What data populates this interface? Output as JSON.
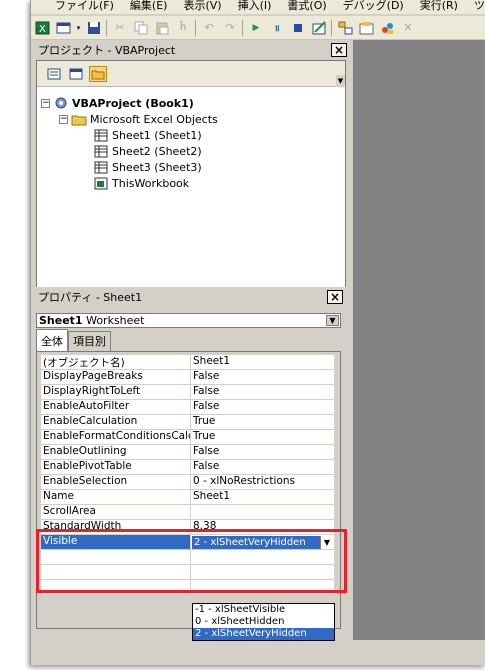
{
  "menubar": {
    "items": [
      "ファイル(F)",
      "編集(E)",
      "表示(V)",
      "挿入(I)",
      "書式(O)",
      "デバッグ(D)",
      "実行(R)",
      "ツ"
    ]
  },
  "toolbar": {
    "icons": [
      "excel-icon",
      "insert-module-icon",
      "save-icon",
      "cut-icon",
      "copy-icon",
      "paste-icon",
      "find-icon",
      "undo-icon",
      "redo-icon",
      "run-icon",
      "pause-icon",
      "stop-icon",
      "design-mode-icon",
      "project-explorer-icon",
      "properties-icon",
      "object-browser-icon",
      "toolbox-icon"
    ]
  },
  "project_explorer": {
    "title": "プロジェクト - VBAProject",
    "close": "×",
    "tree": {
      "root": "VBAProject (Book1)",
      "folder": "Microsoft Excel Objects",
      "items": [
        "Sheet1 (Sheet1)",
        "Sheet2 (Sheet2)",
        "Sheet3 (Sheet3)",
        "ThisWorkbook"
      ]
    }
  },
  "properties": {
    "title": "プロパティ - Sheet1",
    "close": "×",
    "object_name": "Sheet1",
    "object_type": "Worksheet",
    "tabs": [
      "全体",
      "項目別"
    ],
    "rows": [
      {
        "name": "(オブジェクト名)",
        "value": "Sheet1"
      },
      {
        "name": "DisplayPageBreaks",
        "value": "False"
      },
      {
        "name": "DisplayRightToLeft",
        "value": "False"
      },
      {
        "name": "EnableAutoFilter",
        "value": "False"
      },
      {
        "name": "EnableCalculation",
        "value": "True"
      },
      {
        "name": "EnableFormatConditionsCalculation",
        "value": "True"
      },
      {
        "name": "EnableOutlining",
        "value": "False"
      },
      {
        "name": "EnablePivotTable",
        "value": "False"
      },
      {
        "name": "EnableSelection",
        "value": "0 - xlNoRestrictions"
      },
      {
        "name": "Name",
        "value": "Sheet1"
      },
      {
        "name": "ScrollArea",
        "value": ""
      },
      {
        "name": "StandardWidth",
        "value": "8.38"
      }
    ],
    "visible": {
      "name": "Visible",
      "value": "2 - xlSheetVeryHidden",
      "options": [
        "-1 - xlSheetVisible",
        "0 - xlSheetHidden",
        "2 - xlSheetVeryHidden"
      ],
      "selected_index": 2
    }
  },
  "colors": {
    "accent": "#316ac5",
    "highlight": "#e8202a"
  }
}
